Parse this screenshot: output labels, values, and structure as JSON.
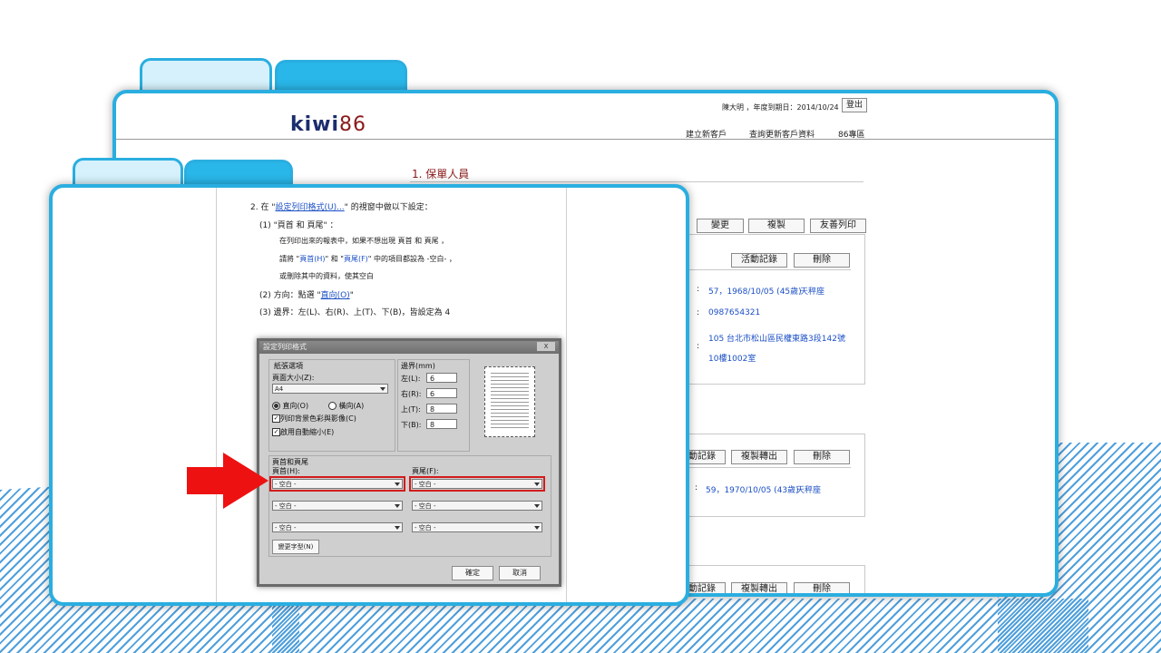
{
  "back_screen": {
    "logo": {
      "text": "kiwi",
      "suffix": "86"
    },
    "user_line": "陳大明 ，年度到期日：2014/10/24",
    "logout_button": "登出",
    "nav": [
      "建立新客戶",
      "查詢更新客戶資料",
      "86專區"
    ],
    "section_title": "1. 保單人員",
    "toolbar": [
      "變更",
      "複製",
      "友善列印"
    ],
    "person1": {
      "buttons": [
        "活動記錄",
        "刪除"
      ],
      "rows": [
        "57，1968/10/05 (45歲)",
        "天秤座",
        "0987654321",
        "105 台北市松山區民權東路3段142號",
        "10樓1002室"
      ]
    },
    "person2": {
      "buttons": [
        "活動記錄",
        "複製轉出",
        "刪除"
      ],
      "rows": [
        "59，1970/10/05 (43歲)",
        "天秤座"
      ]
    },
    "person3": {
      "buttons": [
        "活動記錄",
        "複製轉出",
        "刪除"
      ]
    },
    "colon": ":"
  },
  "front_screen": {
    "instructions": {
      "step2_prefix": "2. 在",
      "step2_link": "設定列印格式(U)...",
      "step2_suffix": "的視窗中做以下設定：",
      "item1_title": "(1) \"頁首 和 頁尾\" ：",
      "item1_line1": "在列印出來的報表中，如果不想出現 頁首 和 頁尾 ，",
      "item1_line2_pre": "請將 \"",
      "item1_line2_header": "頁首(H)",
      "item1_line2_mid": "\" 和 \"",
      "item1_line2_footer": "頁尾(F)",
      "item1_line2_post": "\" 中的項目都設為 -空白- ，",
      "item1_line3": "或刪除其中的資料，使其空白",
      "item2_pre": "(2) 方向：點選 \"",
      "item2_link": "直向(O)",
      "item2_post": "\"",
      "item3": "(3) 邊界：左(L)、右(R)、上(T)、下(B)，皆設定為 4"
    },
    "dialog": {
      "title": "設定列印格式",
      "close": "X",
      "paper_group": "紙張選項",
      "paper_size_label": "頁面大小(Z):",
      "paper_size_value": "A4",
      "orientation_portrait": "直向(O)",
      "orientation_landscape": "橫向(A)",
      "print_bg": "列印背景色彩與影像(C)",
      "shrink": "啟用自動縮小(E)",
      "margins_group": "邊界(mm)",
      "margin_left_label": "左(L):",
      "margin_left": "6",
      "margin_right_label": "右(R):",
      "margin_right": "6",
      "margin_top_label": "上(T):",
      "margin_top": "8",
      "margin_bottom_label": "下(B):",
      "margin_bottom": "8",
      "hf_group": "頁首和頁尾",
      "header_label": "頁首(H):",
      "footer_label": "頁尾(F):",
      "header_values": [
        "- 空白 -",
        "- 空白 -",
        "- 空白 -"
      ],
      "footer_values": [
        "- 空白 -",
        "- 空白 -",
        "- 空白 -"
      ],
      "font_button": "變更字型(N)",
      "ok": "確定",
      "cancel": "取消"
    }
  },
  "colors": {
    "accent": "#2aaee0",
    "arrow": "#ee1111",
    "title": "#8b1a1a",
    "logo": "#1c2d6e"
  }
}
